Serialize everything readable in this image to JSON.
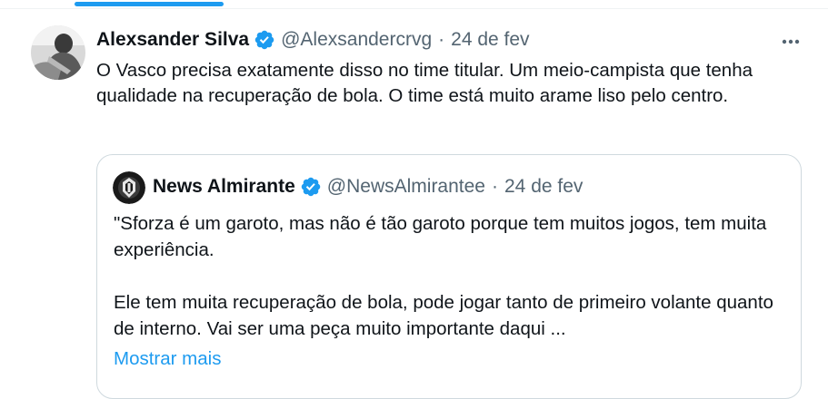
{
  "tweet": {
    "author_name": "Alexsander Silva",
    "handle": "@Alexsandercrvg",
    "separator": "·",
    "date": "24 de fev",
    "text": "O Vasco precisa exatamente disso no time titular. Um meio-campista que tenha qualidade na recuperação de bola. O time está muito arame liso pelo centro.",
    "avatar_icon": "user-avatar-photo",
    "verified_icon": "verified-badge-icon",
    "more_icon": "more-options-icon"
  },
  "quote": {
    "author_name": "News Almirante",
    "handle": "@NewsAlmirantee",
    "separator": "·",
    "date": "24 de fev",
    "paragraph1": "\"Sforza é um garoto, mas não é tão garoto porque tem muitos jogos, tem muita experiência.",
    "paragraph2": "Ele tem muita recuperação de bola, pode jogar tanto de primeiro volante quanto de interno. Vai ser uma peça muito importante daqui ...",
    "show_more": "Mostrar mais",
    "avatar_icon": "news-logo-avatar",
    "verified_icon": "verified-badge-icon"
  },
  "colors": {
    "accent": "#1d9bf0",
    "text_primary": "#0f1419",
    "text_secondary": "#536471",
    "border": "#cfd9de"
  }
}
